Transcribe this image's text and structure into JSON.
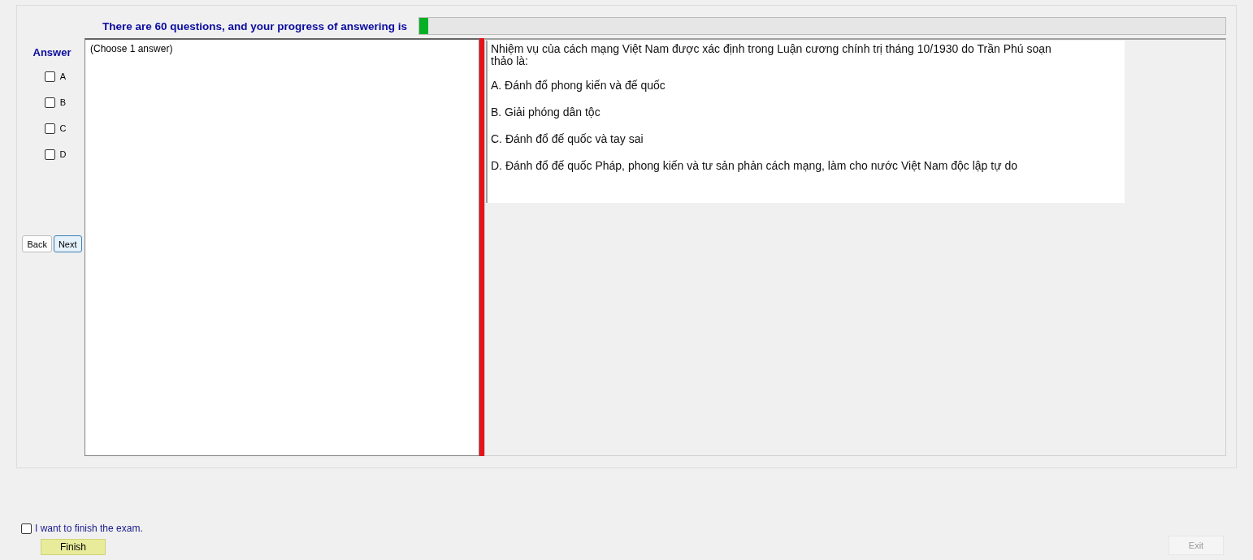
{
  "header": {
    "text": "There are 60 questions, and your progress of answering is",
    "progress": {
      "level": 0.011
    }
  },
  "answer_panel": {
    "title": "Answer",
    "options": [
      {
        "label": "A",
        "checked": false
      },
      {
        "label": "B",
        "checked": false
      },
      {
        "label": "C",
        "checked": false
      },
      {
        "label": "D",
        "checked": false
      }
    ],
    "buttons": [
      {
        "label": "Back",
        "selected": false
      },
      {
        "label": "Next",
        "selected": true
      }
    ]
  },
  "answer_box": {
    "text": "(Choose 1 answer)"
  },
  "question": {
    "text": "Nhiệm vụ của cách mạng Việt Nam được xác định trong Luận cương chính trị tháng 10/1930 do Trần Phú soạn thảo là:",
    "choices": [
      "A.  Đánh đổ phong kiến và đế quốc",
      "B.  Giải phóng dân tộc",
      "C.  Đánh đổ đế quốc và tay sai",
      "D.  Đánh đổ đế quốc Pháp, phong kiến và tư sản phản cách mạng, làm cho nước Việt Nam độc lập tự do"
    ]
  },
  "finish": {
    "label": "I want to finish the exam.",
    "checked": false,
    "button": "Finish"
  },
  "exit": {
    "label": "Exit",
    "disabled": true
  }
}
